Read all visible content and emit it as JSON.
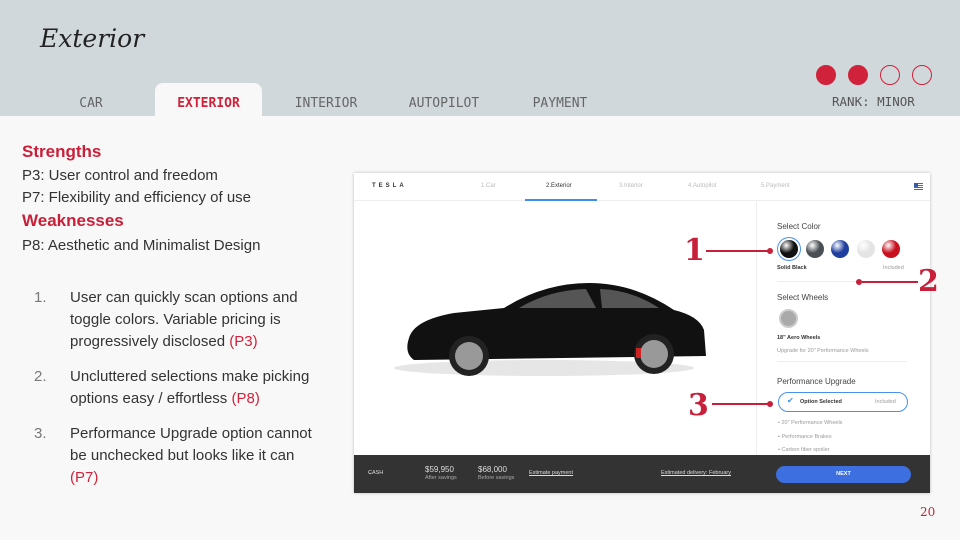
{
  "header": {
    "title": "Exterior",
    "tabs": [
      "CAR",
      "EXTERIOR",
      "INTERIOR",
      "AUTOPILOT",
      "PAYMENT"
    ],
    "active_tab": "EXTERIOR",
    "rank": "RANK: MINOR",
    "rank_level": 2,
    "rank_max": 4
  },
  "content": {
    "strengths_heading": "Strengths",
    "strengths": [
      "P3: User control and freedom",
      "P7: Flexibility and efficiency of use"
    ],
    "weaknesses_heading": "Weaknesses",
    "weaknesses": [
      "P8: Aesthetic and Minimalist Design"
    ],
    "items": [
      {
        "num": "1.",
        "text": "User can quickly scan options and toggle colors. Variable pricing is progressively disclosed ",
        "ref": "(P3)"
      },
      {
        "num": "2.",
        "text": "Uncluttered selections make picking options easy / effortless ",
        "ref": "(P8)"
      },
      {
        "num": "3.",
        "text": "Performance Upgrade option cannot be unchecked but looks like it can ",
        "ref": "(P7)"
      }
    ]
  },
  "screenshot": {
    "logo": "TESLA",
    "steps": [
      "1.Car",
      "2.Exterior",
      "3.Interior",
      "4.Autopilot",
      "5.Payment"
    ],
    "color_title": "Select Color",
    "colors": [
      "#111111",
      "#4a4e55",
      "#1f3f9e",
      "#e4e4e4",
      "#c8101e"
    ],
    "color_name": "Solid Black",
    "color_price": "Included",
    "wheels_title": "Select Wheels",
    "wheel_name": "18\" Aero Wheels",
    "wheel_upgrade": "Upgrade for 20\" Performance Wheels",
    "perf_title": "Performance Upgrade",
    "perf_option": "Option Selected",
    "perf_price": "Included",
    "perf_features": [
      "20\" Performance Wheels",
      "Performance Brakes",
      "Carbon fiber spoiler"
    ],
    "bottom": {
      "payment": "CASH",
      "price1": "$59,950",
      "price1_label": "After savings",
      "price2": "$68,000",
      "price2_label": "Before savings",
      "estimate": "Estimate payment",
      "delivery": "Estimated delivery: February",
      "next": "NEXT"
    }
  },
  "annotations": [
    "1",
    "2",
    "3"
  ],
  "page_number": "20",
  "colors": {
    "accent": "#c8203a",
    "header_bg": "#d0d8dc",
    "link_blue": "#3e6fe0"
  }
}
